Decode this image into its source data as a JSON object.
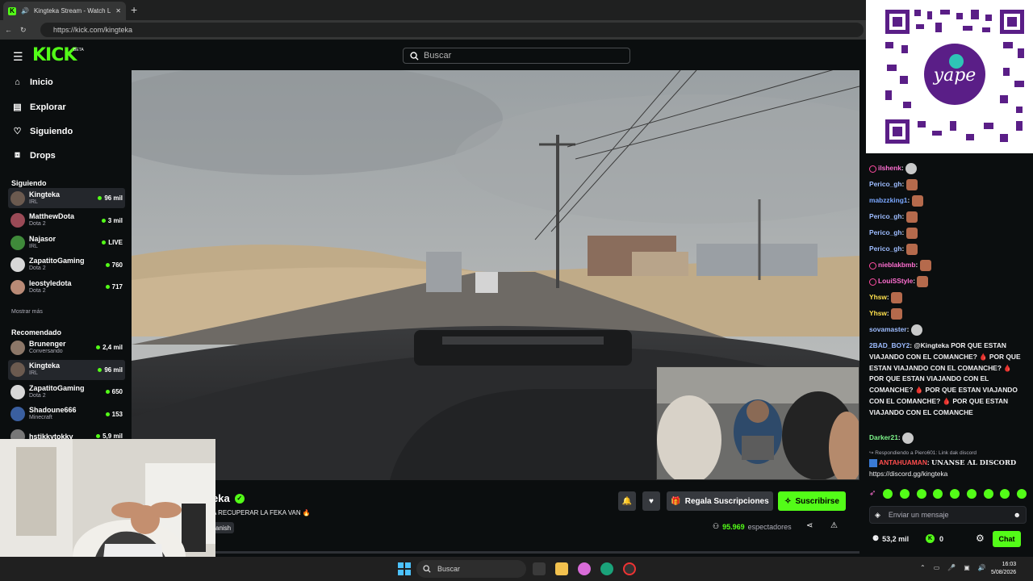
{
  "browser": {
    "tab_title": "Kingteka Stream - Watch Live",
    "tab_close": "✕",
    "new_tab": "+",
    "url": "https://kick.com/kingteka"
  },
  "site": {
    "logo": "KICK",
    "beta": "BETA",
    "search_placeholder": "Buscar"
  },
  "sidebar": {
    "nav": [
      {
        "label": "Inicio",
        "icon": "home-icon"
      },
      {
        "label": "Explorar",
        "icon": "browse-icon"
      },
      {
        "label": "Siguiendo",
        "icon": "heart-icon"
      },
      {
        "label": "Drops",
        "icon": "drops-icon"
      }
    ],
    "following_title": "Siguiendo",
    "following": [
      {
        "name": "Kingteka",
        "category": "IRL",
        "viewers": "96 mil",
        "active": true,
        "avatar": "#6b5a4f"
      },
      {
        "name": "MatthewDota",
        "category": "Dota 2",
        "viewers": "3 mil",
        "active": false,
        "avatar": "#9a4a56"
      },
      {
        "name": "Najasor",
        "category": "IRL",
        "viewers": "LIVE",
        "active": false,
        "avatar": "#3f8a3a"
      },
      {
        "name": "ZapatitoGaming",
        "category": "Dota 2",
        "viewers": "760",
        "active": false,
        "avatar": "#d7d7d7"
      },
      {
        "name": "leostyledota",
        "category": "Dota 2",
        "viewers": "717",
        "active": false,
        "avatar": "#b98a76"
      }
    ],
    "show_more": "Mostrar más",
    "recommended_title": "Recomendado",
    "recommended": [
      {
        "name": "Brunenger",
        "category": "Conversando",
        "viewers": "2,4 mil",
        "active": false,
        "avatar": "#8c7768"
      },
      {
        "name": "Kingteka",
        "category": "IRL",
        "viewers": "96 mil",
        "active": true,
        "avatar": "#6b5a4f"
      },
      {
        "name": "ZapatitoGaming",
        "category": "Dota 2",
        "viewers": "650",
        "active": false,
        "avatar": "#d7d7d7"
      },
      {
        "name": "Shadoune666",
        "category": "Minecraft",
        "viewers": "153",
        "active": false,
        "avatar": "#3a5fa0"
      },
      {
        "name": "hstikkytokky",
        "category": "",
        "viewers": "5,9 mil",
        "active": false,
        "avatar": "#777"
      }
    ]
  },
  "stream": {
    "streamer_partial": "eka",
    "title_partial": "A RECUPERAR LA FEKA VAN 🔥",
    "tag_partial": "anish",
    "gift_label": "Regala Suscripciones",
    "subscribe_label": "Suscribirse",
    "viewers": "95.969",
    "viewers_suffix": "espectadores"
  },
  "chat": {
    "messages": [
      {
        "user": "ilshenk",
        "color": "u-pink",
        "badge": true,
        "emote": "cat"
      },
      {
        "user": "Perico_gh",
        "color": "u-lblue",
        "badge": false,
        "emote": "face"
      },
      {
        "user": "mabzzking1",
        "color": "u-blue",
        "badge": false,
        "emote": "face"
      },
      {
        "user": "Perico_gh",
        "color": "u-lblue",
        "badge": false,
        "emote": "face"
      },
      {
        "user": "Perico_gh",
        "color": "u-lblue",
        "badge": false,
        "emote": "face"
      },
      {
        "user": "Perico_gh",
        "color": "u-lblue",
        "badge": false,
        "emote": "face"
      },
      {
        "user": "nieblakbmb",
        "color": "u-pink",
        "badge": true,
        "emote": "face"
      },
      {
        "user": "LouiSStyle",
        "color": "u-pink",
        "badge": true,
        "emote": "face"
      },
      {
        "user": "Yhsw",
        "color": "u-yellow",
        "badge": false,
        "emote": "face"
      },
      {
        "user": "Yhsw",
        "color": "u-yellow",
        "badge": false,
        "emote": "face"
      },
      {
        "user": "sovamaster",
        "color": "u-lblue",
        "badge": false,
        "emote": "cat"
      }
    ],
    "long_msg_user": "2BAD_BOY2",
    "long_msg_text": "@Kingteka POR QUE ESTAN VIAJANDO CON EL COMANCHE? 🩸 POR QUE ESTAN VIAJANDO CON EL COMANCHE? 🩸 POR QUE ESTAN VIAJANDO CON EL COMANCHE? 🩸 POR QUE ESTAN VIAJANDO CON EL COMANCHE? 🩸 POR QUE ESTAN VIAJANDO CON EL COMANCHE",
    "darker_user": "Darker21",
    "reply_note": "↪ Respondiendo a Piero601: Link dak discord",
    "discord_user": "ANTAHUAMAN",
    "discord_text": "UNANSE AL DISCORD",
    "discord_link": "https://discord.gg/kingteka",
    "input_placeholder": "Enviar un mensaje",
    "points": "53,2 mil",
    "kick_points": "0",
    "chat_button": "Chat"
  },
  "taskbar": {
    "search": "Buscar",
    "time": "16:03",
    "date": "5/08/2026"
  }
}
